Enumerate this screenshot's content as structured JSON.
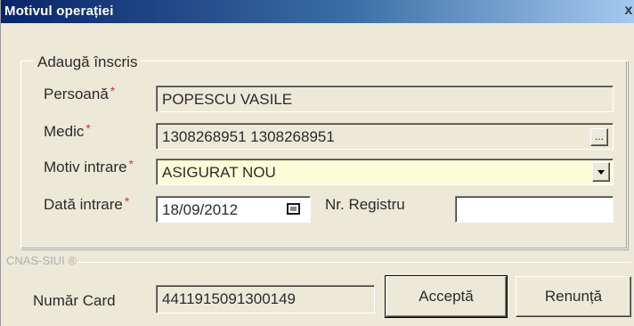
{
  "window": {
    "title": "Motivul operației",
    "close_glyph": "x"
  },
  "group": {
    "legend": "Adaugă înscris"
  },
  "form": {
    "persoana": {
      "label": "Persoană",
      "required": "*",
      "value": "POPESCU VASILE"
    },
    "medic": {
      "label": "Medic",
      "required": "*",
      "value": "1308268951 1308268951",
      "browse_glyph": "..."
    },
    "motiv": {
      "label": "Motiv intrare",
      "required": "*",
      "value": "ASIGURAT NOU"
    },
    "data": {
      "label": "Dată intrare",
      "required": "*",
      "value": "18/09/2012"
    },
    "registru": {
      "label": "Nr. Registru",
      "value": ""
    }
  },
  "cnas": {
    "label": "CNAS-SIUI ®"
  },
  "card": {
    "label": "Număr Card",
    "value": "4411915091300149"
  },
  "buttons": {
    "accept": "Acceptă",
    "cancel": "Renunță"
  },
  "colors": {
    "title_start": "#0a246a",
    "title_end": "#a6caf0",
    "required": "#e0303b",
    "selected_field": "#fefdd8",
    "dialog_bg": "#ece9d8"
  }
}
